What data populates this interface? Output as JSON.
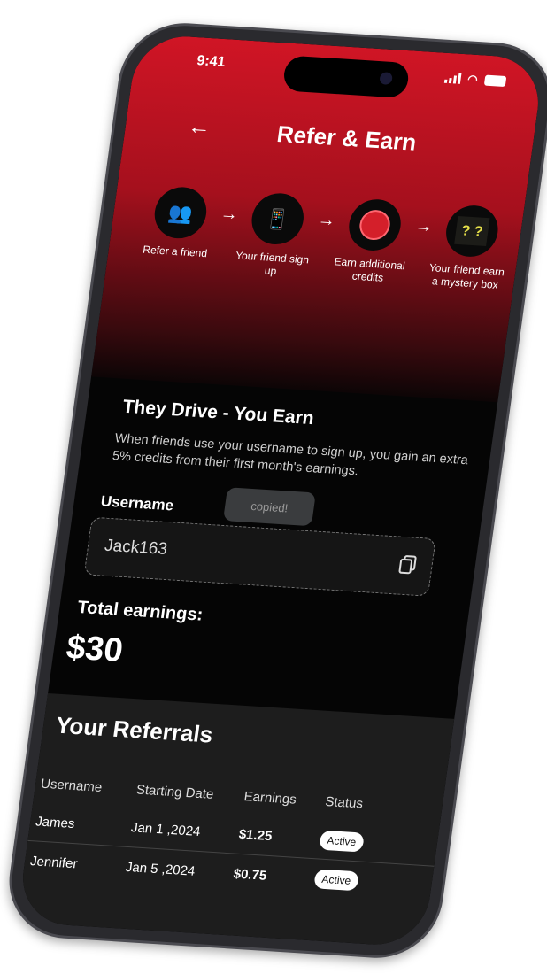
{
  "status_bar": {
    "time": "9:41"
  },
  "header": {
    "back_icon": "arrow-left-icon",
    "title": "Refer & Earn"
  },
  "steps": [
    {
      "label": "Refer a friend",
      "icon": "users-icon"
    },
    {
      "label": "Your friend sign up",
      "icon": "phone-check-icon"
    },
    {
      "label": "Earn additional credits",
      "icon": "credit-coin-icon"
    },
    {
      "label": "Your friend earn a mystery box",
      "icon": "mystery-box-icon",
      "glyph": "? ?"
    }
  ],
  "info": {
    "heading": "They Drive - You Earn",
    "description": "When friends use your username to sign up, you gain an extra 5% credits from their first month's earnings."
  },
  "username": {
    "label": "Username",
    "value": "Jack163",
    "toast": "copied!"
  },
  "earnings": {
    "label": "Total earnings:",
    "value": "$30"
  },
  "referrals": {
    "title": "Your Referrals",
    "columns": [
      "Username",
      "Starting Date",
      "Earnings",
      "Status"
    ],
    "rows": [
      {
        "username": "James",
        "date": "Jan 1 ,2024",
        "earnings": "$1.25",
        "status": "Active"
      },
      {
        "username": "Jennifer",
        "date": "Jan 5 ,2024",
        "earnings": "$0.75",
        "status": "Active"
      }
    ]
  },
  "colors": {
    "accent": "#d01525",
    "background": "#050505"
  }
}
